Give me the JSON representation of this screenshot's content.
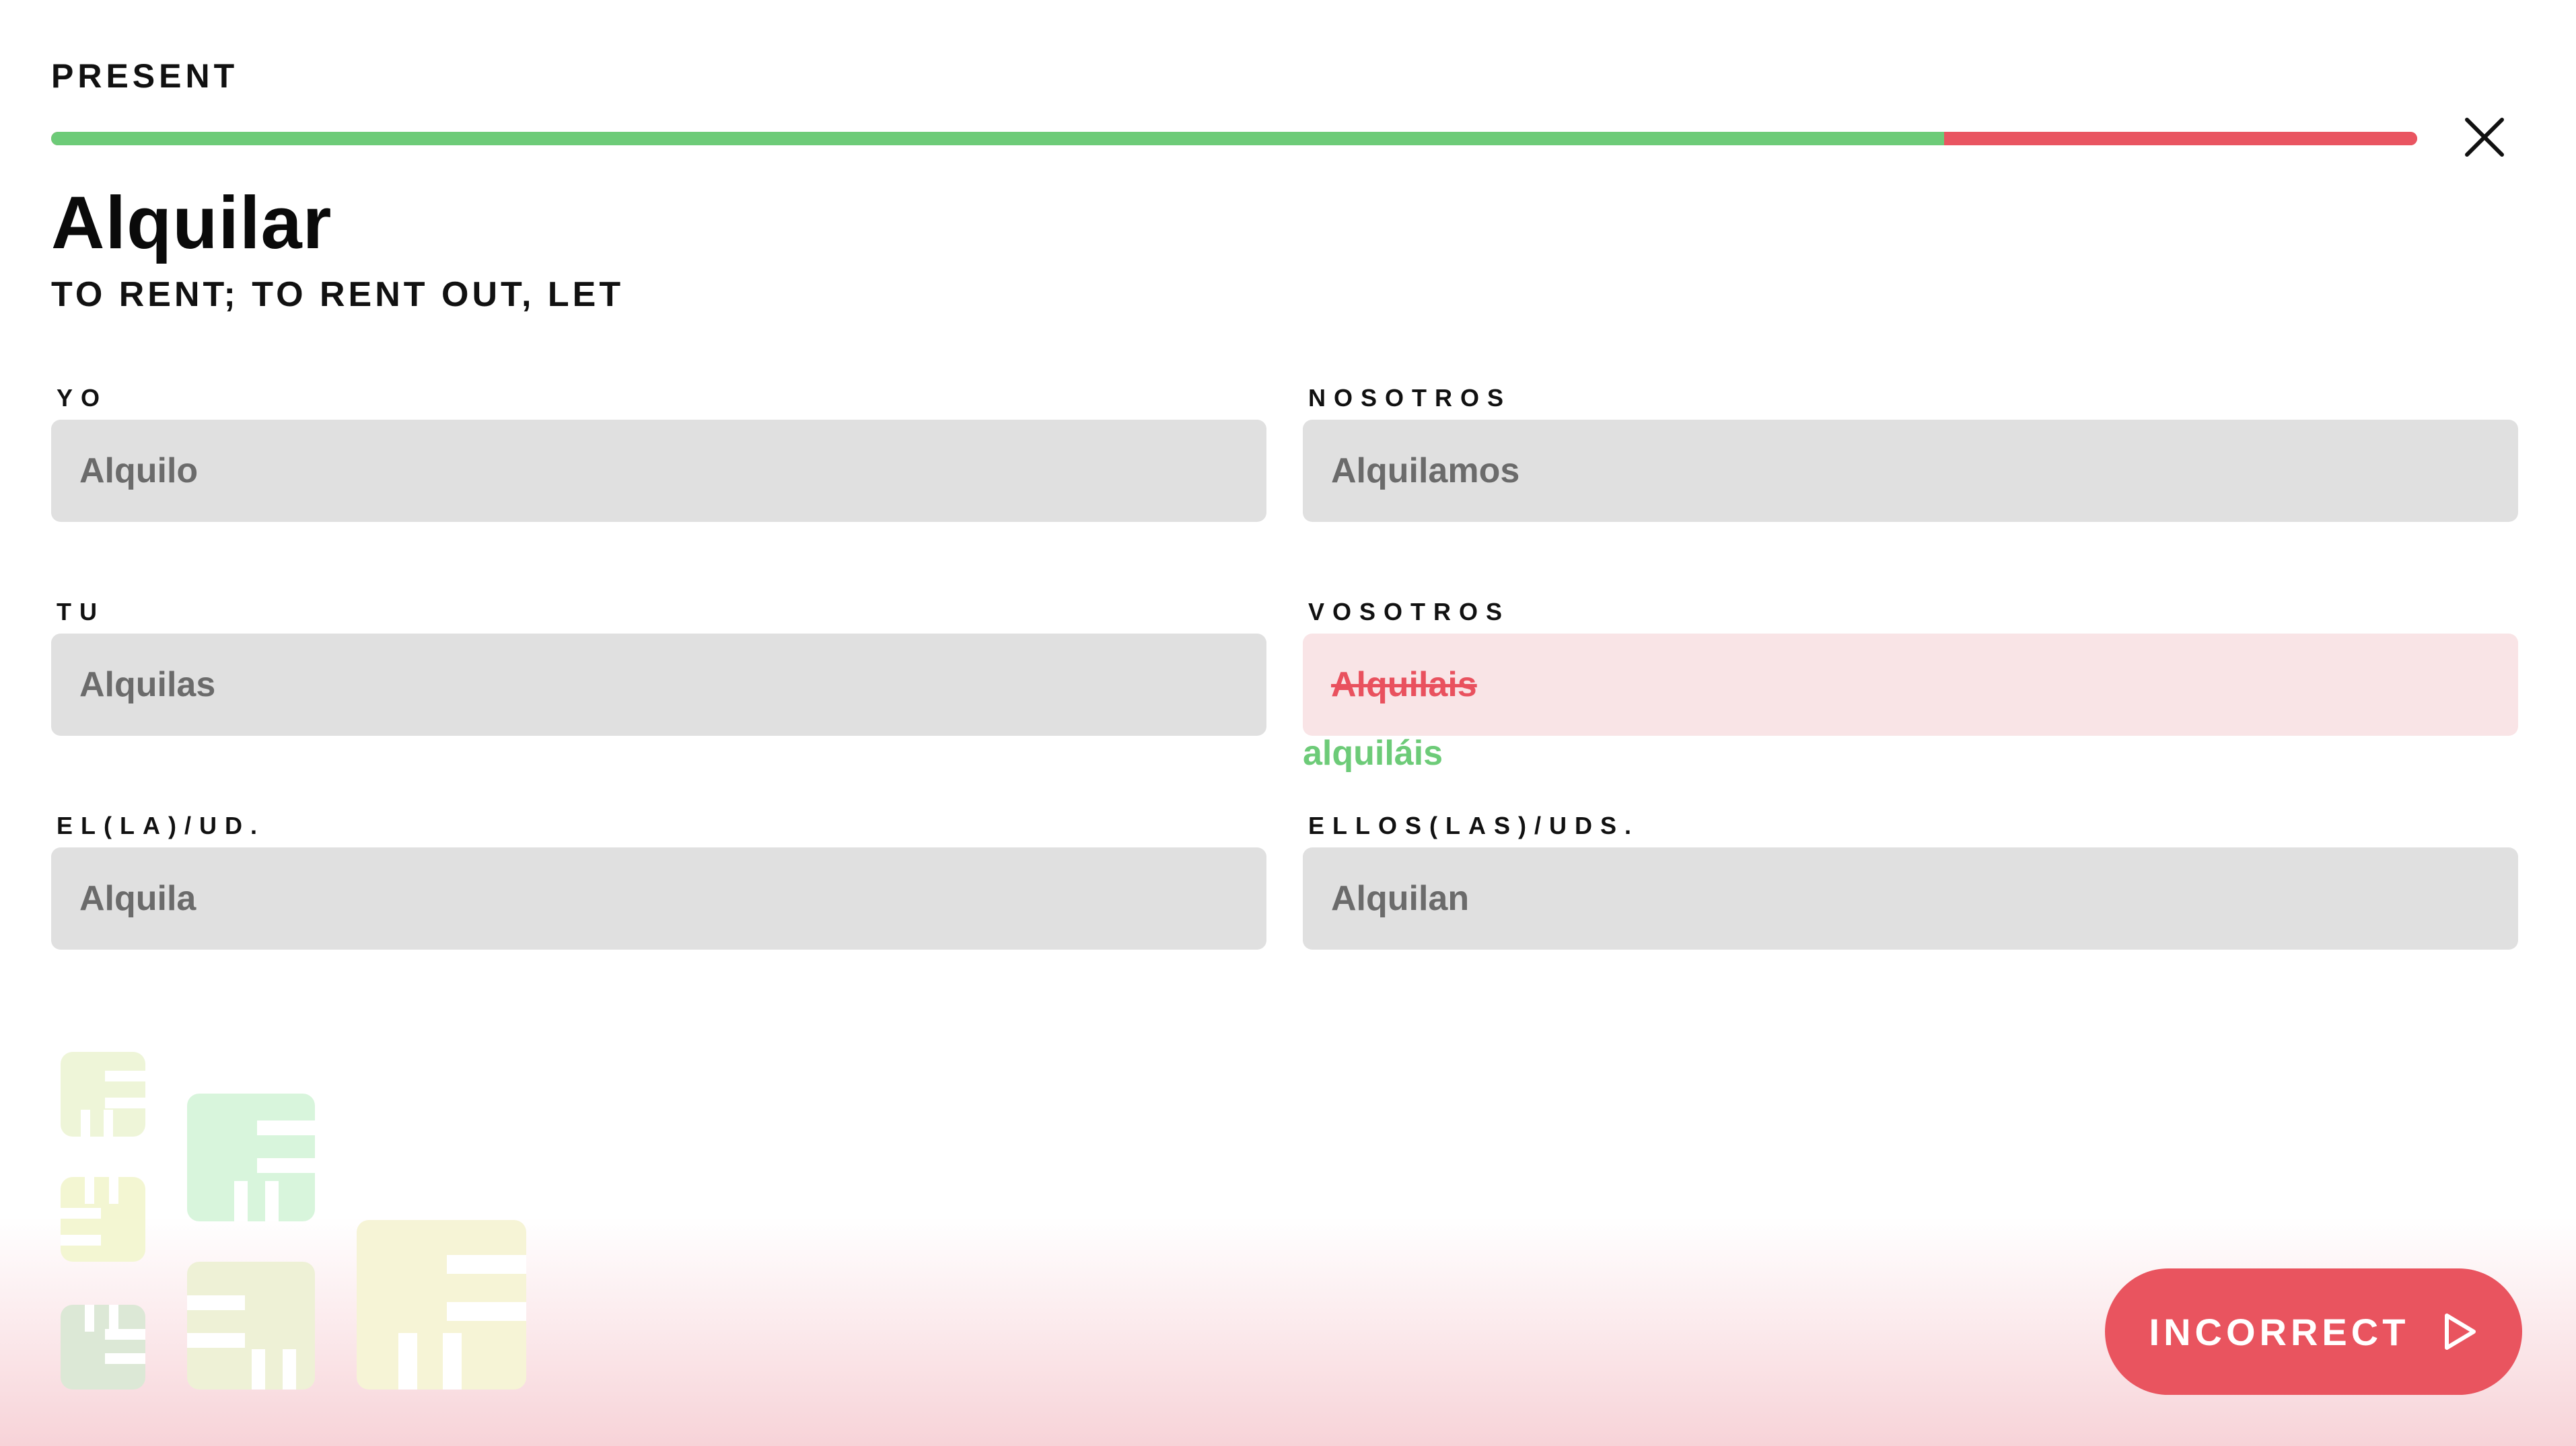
{
  "header": {
    "tense": "PRESENT",
    "close_icon": "close-icon"
  },
  "progress": {
    "correct_fraction": 0.8,
    "correct_color": "#6dcb78",
    "incorrect_color": "#e95561"
  },
  "verb": {
    "infinitive": "Alquilar",
    "meaning": "TO RENT; TO RENT OUT, LET"
  },
  "conjugations": [
    {
      "pronoun": "YO",
      "answer": "Alquilo",
      "status": "correct"
    },
    {
      "pronoun": "NOSOTROS",
      "answer": "Alquilamos",
      "status": "correct"
    },
    {
      "pronoun": "TU",
      "answer": "Alquilas",
      "status": "correct"
    },
    {
      "pronoun": "VOSOTROS",
      "answer": "Alquilais",
      "status": "incorrect",
      "correction": "alquiláis"
    },
    {
      "pronoun": "EL(LA)/UD.",
      "answer": "Alquila",
      "status": "correct"
    },
    {
      "pronoun": "ELLOS(LAS)/UDS.",
      "answer": "Alquilan",
      "status": "correct"
    }
  ],
  "footer": {
    "action_label": "INCORRECT",
    "action_icon": "play-outline-icon",
    "action_color": "#e9545f"
  },
  "decor": {
    "icon": "block-pattern-decoration"
  }
}
